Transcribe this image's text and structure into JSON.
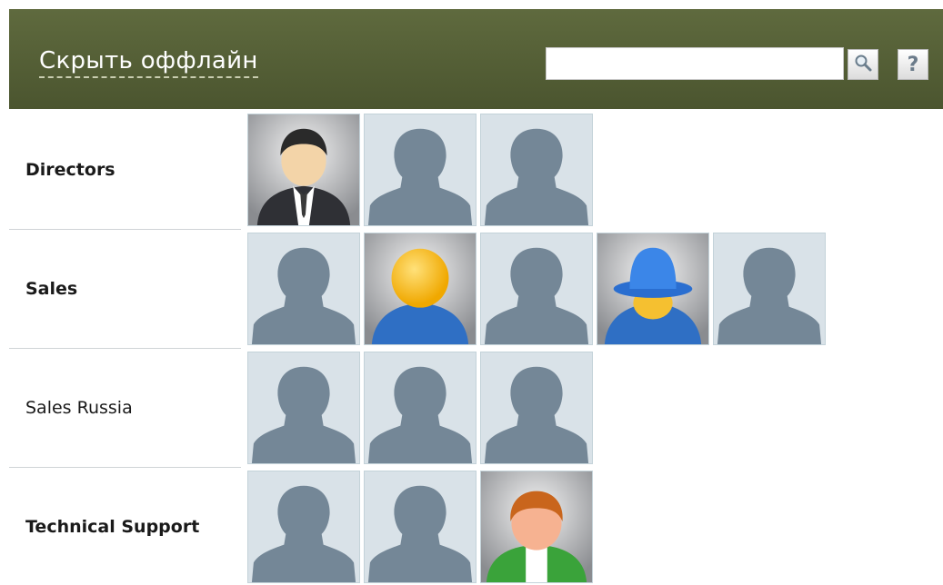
{
  "header": {
    "hide_offline_label": "Скрыть оффлайн",
    "search": {
      "value": "",
      "placeholder": ""
    },
    "search_icon": "magnifier-icon",
    "help_label": "?"
  },
  "colors": {
    "header_bg": "#55603a",
    "placeholder_silhouette": "#748797",
    "placeholder_bg": "#d9e2e8"
  },
  "groups": [
    {
      "name": "Directors",
      "bold": true,
      "avatars": [
        "director-avatar",
        "placeholder",
        "placeholder"
      ]
    },
    {
      "name": "Sales",
      "bold": true,
      "avatars": [
        "placeholder",
        "yellow-head-avatar",
        "placeholder",
        "blue-hat-avatar",
        "placeholder"
      ]
    },
    {
      "name": "Sales Russia",
      "bold": false,
      "avatars": [
        "placeholder",
        "placeholder",
        "placeholder"
      ]
    },
    {
      "name": "Technical Support",
      "bold": true,
      "avatars": [
        "placeholder",
        "placeholder",
        "green-shirt-avatar"
      ]
    }
  ]
}
